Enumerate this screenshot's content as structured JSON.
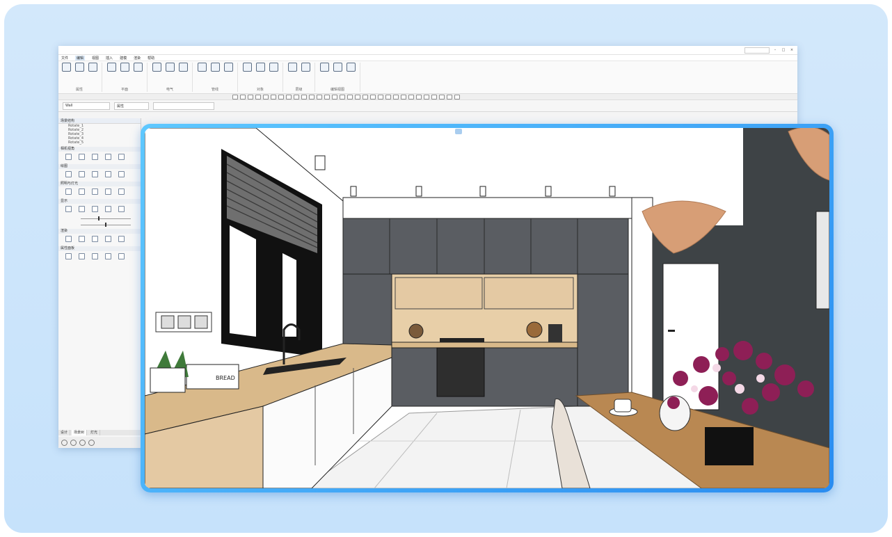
{
  "app": {
    "title": "",
    "menus": [
      "文件",
      "编辑",
      "视图",
      "插入",
      "建模",
      "渲染",
      "帮助"
    ],
    "active_menu": 1,
    "ribbon_groups": [
      {
        "caption": "属性",
        "buttons": 3
      },
      {
        "caption": "平面",
        "buttons": 3
      },
      {
        "caption": "电气",
        "buttons": 3
      },
      {
        "caption": "管线",
        "buttons": 3
      },
      {
        "caption": "对象",
        "buttons": 3
      },
      {
        "caption": "层级",
        "buttons": 2
      },
      {
        "caption": "编辑视图",
        "buttons": 3
      }
    ],
    "toolbar_icon_count": 30,
    "propbar": {
      "field1": "Wall",
      "field2": "属性",
      "field3": "",
      "label": ""
    },
    "sidebar": {
      "header": "场景结构",
      "tree": [
        "Rotate_1",
        "Rotate_2",
        "Rotate_3",
        "Rotate_4",
        "Rotate_5"
      ],
      "sections": [
        "相机视角",
        "绘图",
        "照明与灯光",
        "显示",
        "渲染",
        "属性面板"
      ],
      "tabs": [
        "设计",
        "场景树",
        "灯光"
      ]
    },
    "viewport_tag": ""
  },
  "colors": {
    "frame_bg": "#c9e4fb",
    "accent_border": "#3aa7f7",
    "cabinet_dark": "#5a5d62",
    "wood": "#e4c9a3",
    "wall_dark": "#3e4346",
    "lamp": "#d79e76",
    "flowers": "#8e1f56"
  }
}
